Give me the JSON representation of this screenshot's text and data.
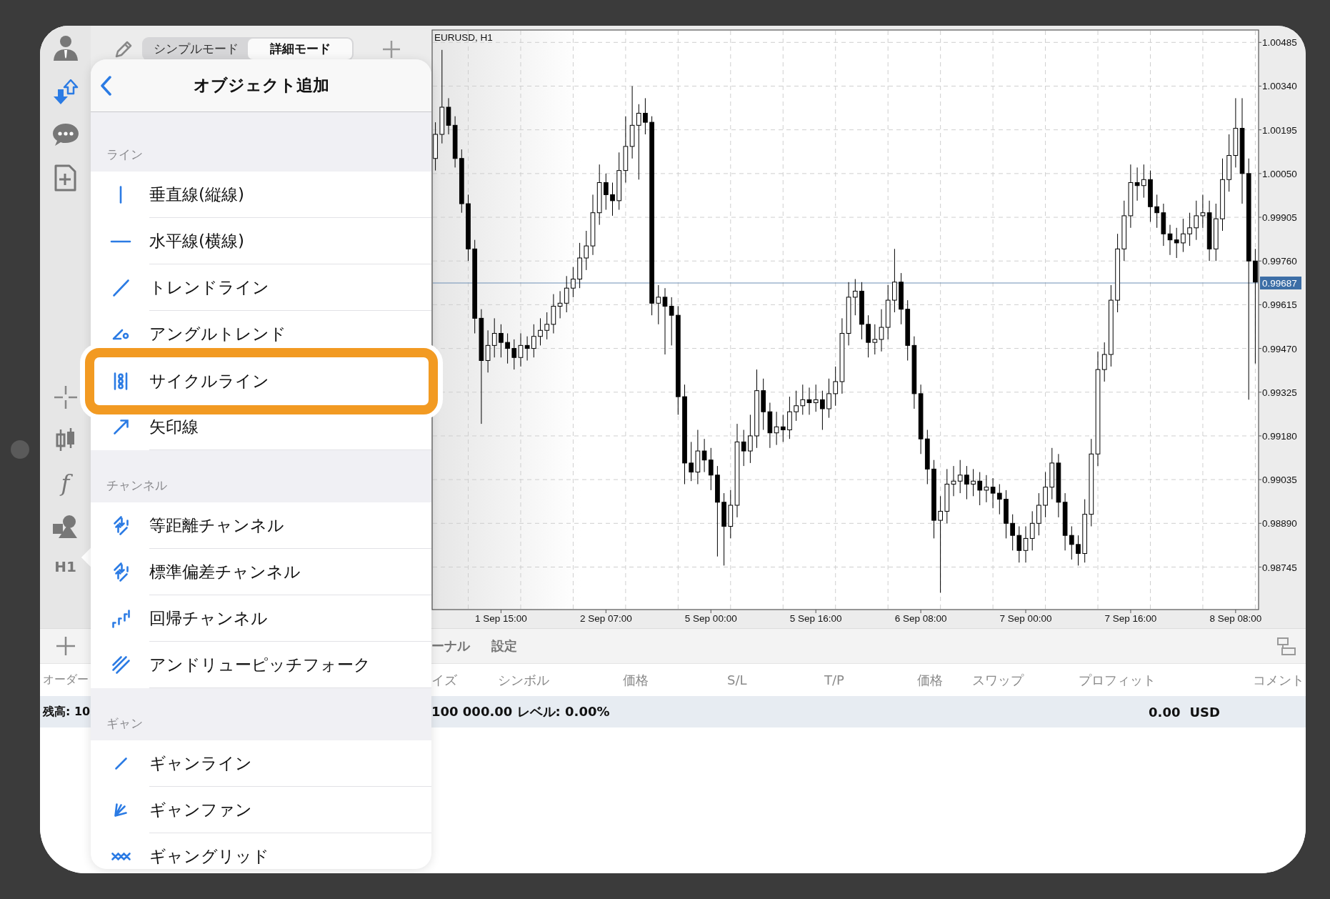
{
  "sidebar": {
    "indicator_glyph": "f",
    "timeframe": "H1"
  },
  "mode_tabs": [
    {
      "label": "シンプルモード",
      "selected": false
    },
    {
      "label": "詳細モード",
      "selected": true
    }
  ],
  "popover": {
    "title": "オブジェクト追加",
    "sections": [
      {
        "title": "ライン",
        "items": [
          {
            "label": "垂直線(縦線)",
            "selected": false
          },
          {
            "label": "水平線(横線)",
            "selected": false
          },
          {
            "label": "トレンドライン",
            "selected": false
          },
          {
            "label": "アングルトレンド",
            "selected": false
          },
          {
            "label": "サイクルライン",
            "selected": true
          },
          {
            "label": "矢印線",
            "selected": false
          }
        ]
      },
      {
        "title": "チャンネル",
        "items": [
          {
            "label": "等距離チャンネル",
            "selected": false
          },
          {
            "label": "標準偏差チャンネル",
            "selected": false
          },
          {
            "label": "回帰チャンネル",
            "selected": false
          },
          {
            "label": "アンドリューピッチフォーク",
            "selected": false
          }
        ]
      },
      {
        "title": "ギャン",
        "items": [
          {
            "label": "ギャンライン",
            "selected": false
          },
          {
            "label": "ギャンファン",
            "selected": false
          },
          {
            "label": "ギャングリッド",
            "selected": false
          }
        ]
      }
    ]
  },
  "chart": {
    "chart_data": {
      "type": "candlestick",
      "title": "EURUSD, H1",
      "grid": true,
      "ref_lines": [
        {
          "axis": "y",
          "value": 0.99687,
          "label": "0.99687"
        }
      ],
      "categories": [
        null,
        null,
        null,
        null,
        null,
        null,
        null,
        null,
        null,
        null,
        "1 Sep 15:00",
        null,
        null,
        null,
        null,
        null,
        null,
        null,
        null,
        null,
        null,
        null,
        null,
        null,
        null,
        null,
        "2 Sep 07:00",
        null,
        null,
        null,
        null,
        null,
        null,
        null,
        null,
        null,
        null,
        null,
        null,
        null,
        null,
        null,
        "5 Sep 00:00",
        null,
        null,
        null,
        null,
        null,
        null,
        null,
        null,
        null,
        null,
        null,
        null,
        null,
        null,
        null,
        "5 Sep 16:00",
        null,
        null,
        null,
        null,
        null,
        null,
        null,
        null,
        null,
        null,
        null,
        null,
        null,
        null,
        null,
        "6 Sep 08:00",
        null,
        null,
        null,
        null,
        null,
        null,
        null,
        null,
        null,
        null,
        null,
        null,
        null,
        null,
        null,
        "7 Sep 00:00",
        null,
        null,
        null,
        null,
        null,
        null,
        null,
        null,
        null,
        null,
        null,
        null,
        null,
        null,
        null,
        "7 Sep 16:00",
        null,
        null,
        null,
        null,
        null,
        null,
        null,
        null,
        null,
        null,
        null,
        null,
        null,
        null,
        null,
        "8 Sep 08:00",
        null,
        null,
        null
      ],
      "ylim": [
        0.98604,
        1.00526
      ],
      "yticks": [
        {
          "value": 1.00485,
          "label": "1.00485"
        },
        {
          "value": 1.0034,
          "label": "1.00340"
        },
        {
          "value": 1.00195,
          "label": "1.00195"
        },
        {
          "value": 1.0005,
          "label": "1.00050"
        },
        {
          "value": 0.99905,
          "label": "0.99905"
        },
        {
          "value": 0.9976,
          "label": "0.99760"
        },
        {
          "value": 0.99615,
          "label": "0.99615"
        },
        {
          "value": 0.9947,
          "label": "0.99470"
        },
        {
          "value": 0.99325,
          "label": "0.99325"
        },
        {
          "value": 0.9918,
          "label": "0.99180"
        },
        {
          "value": 0.99035,
          "label": "0.99035"
        },
        {
          "value": 0.9889,
          "label": "0.98890"
        },
        {
          "value": 0.98745,
          "label": "0.98745"
        }
      ],
      "ohlc": [
        [
          1.001,
          1.0022,
          1.0006,
          1.0018
        ],
        [
          1.0018,
          1.0046,
          1.0015,
          1.0027
        ],
        [
          1.0027,
          1.003,
          1.0018,
          1.0021
        ],
        [
          1.0021,
          1.0024,
          1.0007,
          1.001
        ],
        [
          1.001,
          1.0013,
          0.9992,
          0.9995
        ],
        [
          0.9995,
          0.9998,
          0.9976,
          0.998
        ],
        [
          0.998,
          0.9983,
          0.9952,
          0.9957
        ],
        [
          0.9957,
          0.996,
          0.9922,
          0.9943
        ],
        [
          0.9943,
          0.9953,
          0.9939,
          0.9948
        ],
        [
          0.9948,
          0.9957,
          0.9944,
          0.9952
        ],
        [
          0.9952,
          0.9955,
          0.9944,
          0.9949
        ],
        [
          0.9949,
          0.9952,
          0.9942,
          0.9947
        ],
        [
          0.9947,
          0.995,
          0.994,
          0.9944
        ],
        [
          0.9944,
          0.9952,
          0.9941,
          0.9948
        ],
        [
          0.9948,
          0.9951,
          0.9943,
          0.9947
        ],
        [
          0.9947,
          0.9955,
          0.9944,
          0.9951
        ],
        [
          0.9951,
          0.9957,
          0.9948,
          0.9953
        ],
        [
          0.9953,
          0.9959,
          0.995,
          0.9955
        ],
        [
          0.9955,
          0.9965,
          0.9952,
          0.9961
        ],
        [
          0.9961,
          0.9966,
          0.9957,
          0.9962
        ],
        [
          0.9962,
          0.9971,
          0.9959,
          0.9967
        ],
        [
          0.9967,
          0.9974,
          0.9964,
          0.997
        ],
        [
          0.997,
          0.9982,
          0.9967,
          0.9977
        ],
        [
          0.9977,
          0.9986,
          0.9973,
          0.9981
        ],
        [
          0.9981,
          0.9998,
          0.9978,
          0.9992
        ],
        [
          0.9992,
          1.0008,
          0.9988,
          1.0002
        ],
        [
          1.0002,
          1.0005,
          0.9993,
          0.9998
        ],
        [
          0.9998,
          1.0002,
          0.9991,
          0.9996
        ],
        [
          0.9996,
          1.0012,
          0.9993,
          1.0006
        ],
        [
          1.0006,
          1.0024,
          1.0002,
          1.0014
        ],
        [
          1.0014,
          1.0034,
          1.001,
          1.0021
        ],
        [
          1.0021,
          1.0028,
          1.0003,
          1.0025
        ],
        [
          1.0025,
          1.003,
          1.0018,
          1.0022
        ],
        [
          1.0022,
          1.0024,
          0.9958,
          0.9962
        ],
        [
          0.9962,
          0.9968,
          0.9955,
          0.9964
        ],
        [
          0.9964,
          0.9967,
          0.9945,
          0.9961
        ],
        [
          0.9961,
          0.9964,
          0.9948,
          0.9958
        ],
        [
          0.9958,
          0.9961,
          0.9925,
          0.9931
        ],
        [
          0.9931,
          0.9935,
          0.9902,
          0.9909
        ],
        [
          0.9909,
          0.9916,
          0.9903,
          0.9906
        ],
        [
          0.9906,
          0.992,
          0.9902,
          0.9913
        ],
        [
          0.9913,
          0.9917,
          0.9906,
          0.991
        ],
        [
          0.991,
          0.9914,
          0.99,
          0.9905
        ],
        [
          0.9905,
          0.9908,
          0.9878,
          0.9896
        ],
        [
          0.9896,
          0.9899,
          0.9875,
          0.9888
        ],
        [
          0.9888,
          0.99,
          0.9884,
          0.9895
        ],
        [
          0.9895,
          0.9922,
          0.9891,
          0.9916
        ],
        [
          0.9916,
          0.992,
          0.9908,
          0.9913
        ],
        [
          0.9913,
          0.9925,
          0.9909,
          0.9918
        ],
        [
          0.9918,
          0.994,
          0.9914,
          0.9933
        ],
        [
          0.9933,
          0.9937,
          0.992,
          0.9926
        ],
        [
          0.9926,
          0.9929,
          0.9914,
          0.9919
        ],
        [
          0.9919,
          0.9926,
          0.9915,
          0.9921
        ],
        [
          0.9921,
          0.9925,
          0.9916,
          0.992
        ],
        [
          0.992,
          0.9931,
          0.9917,
          0.9926
        ],
        [
          0.9926,
          0.9933,
          0.9923,
          0.9928
        ],
        [
          0.9928,
          0.9935,
          0.9925,
          0.993
        ],
        [
          0.993,
          0.9934,
          0.9925,
          0.9929
        ],
        [
          0.9929,
          0.9935,
          0.9926,
          0.993
        ],
        [
          0.993,
          0.9933,
          0.992,
          0.9927
        ],
        [
          0.9927,
          0.9937,
          0.9924,
          0.9932
        ],
        [
          0.9932,
          0.9941,
          0.9928,
          0.9936
        ],
        [
          0.9936,
          0.9957,
          0.9932,
          0.9952
        ],
        [
          0.9952,
          0.9969,
          0.9948,
          0.9964
        ],
        [
          0.9964,
          0.997,
          0.9958,
          0.9966
        ],
        [
          0.9966,
          0.9969,
          0.995,
          0.9955
        ],
        [
          0.9955,
          0.9958,
          0.9944,
          0.9949
        ],
        [
          0.9949,
          0.9955,
          0.9945,
          0.995
        ],
        [
          0.995,
          0.996,
          0.9946,
          0.9954
        ],
        [
          0.9954,
          0.9968,
          0.995,
          0.9963
        ],
        [
          0.9963,
          0.998,
          0.9959,
          0.9969
        ],
        [
          0.9969,
          0.9972,
          0.9955,
          0.996
        ],
        [
          0.996,
          0.9963,
          0.9943,
          0.9948
        ],
        [
          0.9948,
          0.9951,
          0.9927,
          0.9932
        ],
        [
          0.9932,
          0.9935,
          0.9912,
          0.9917
        ],
        [
          0.9917,
          0.992,
          0.9902,
          0.9907
        ],
        [
          0.9907,
          0.991,
          0.9884,
          0.989
        ],
        [
          0.989,
          0.9898,
          0.9866,
          0.9893
        ],
        [
          0.9893,
          0.9907,
          0.9889,
          0.9902
        ],
        [
          0.9902,
          0.9908,
          0.9898,
          0.9903
        ],
        [
          0.9903,
          0.991,
          0.9899,
          0.9905
        ],
        [
          0.9905,
          0.9908,
          0.9897,
          0.9902
        ],
        [
          0.9902,
          0.9907,
          0.9898,
          0.9903
        ],
        [
          0.9903,
          0.9906,
          0.9895,
          0.99
        ],
        [
          0.99,
          0.9905,
          0.9896,
          0.9901
        ],
        [
          0.9901,
          0.9904,
          0.9894,
          0.9899
        ],
        [
          0.9899,
          0.9902,
          0.9892,
          0.9897
        ],
        [
          0.9897,
          0.99,
          0.9884,
          0.9889
        ],
        [
          0.9889,
          0.9892,
          0.988,
          0.9885
        ],
        [
          0.9885,
          0.9888,
          0.9876,
          0.988
        ],
        [
          0.988,
          0.9888,
          0.9876,
          0.9884
        ],
        [
          0.9884,
          0.9893,
          0.988,
          0.9889
        ],
        [
          0.9889,
          0.9899,
          0.9885,
          0.9895
        ],
        [
          0.9895,
          0.9906,
          0.9891,
          0.9901
        ],
        [
          0.9901,
          0.9914,
          0.9897,
          0.9909
        ],
        [
          0.9909,
          0.9912,
          0.9891,
          0.9896
        ],
        [
          0.9896,
          0.9899,
          0.988,
          0.9885
        ],
        [
          0.9885,
          0.9888,
          0.9877,
          0.9882
        ],
        [
          0.9882,
          0.9885,
          0.9875,
          0.9879
        ],
        [
          0.9879,
          0.9897,
          0.9876,
          0.9892
        ],
        [
          0.9892,
          0.9917,
          0.9888,
          0.9912
        ],
        [
          0.9912,
          0.9946,
          0.9908,
          0.994
        ],
        [
          0.994,
          0.9949,
          0.9936,
          0.9945
        ],
        [
          0.9945,
          0.9968,
          0.9941,
          0.9963
        ],
        [
          0.9963,
          0.9985,
          0.9959,
          0.998
        ],
        [
          0.998,
          0.9996,
          0.9976,
          0.9991
        ],
        [
          0.9991,
          1.0008,
          0.9987,
          1.0002
        ],
        [
          1.0002,
          1.0007,
          0.9996,
          1.0001
        ],
        [
          1.0001,
          1.0008,
          0.9997,
          1.0003
        ],
        [
          1.0003,
          1.0006,
          0.9989,
          0.9994
        ],
        [
          0.9994,
          0.9998,
          0.9987,
          0.9992
        ],
        [
          0.9992,
          0.9995,
          0.9981,
          0.9985
        ],
        [
          0.9985,
          0.9988,
          0.9978,
          0.9983
        ],
        [
          0.9983,
          0.9987,
          0.9977,
          0.9982
        ],
        [
          0.9982,
          0.999,
          0.9979,
          0.9985
        ],
        [
          0.9985,
          0.9992,
          0.9981,
          0.9987
        ],
        [
          0.9987,
          0.9996,
          0.9983,
          0.9991
        ],
        [
          0.9991,
          0.9998,
          0.9987,
          0.9992
        ],
        [
          0.9992,
          0.9996,
          0.9976,
          0.998
        ],
        [
          0.998,
          0.9995,
          0.9976,
          0.999
        ],
        [
          0.999,
          1.001,
          0.9986,
          1.0003
        ],
        [
          1.0003,
          1.0018,
          0.9999,
          1.0011
        ],
        [
          1.0011,
          1.003,
          1.0007,
          1.002
        ],
        [
          1.002,
          1.003,
          0.9995,
          1.0005
        ],
        [
          1.0005,
          1.001,
          0.993,
          0.9976
        ],
        [
          0.9976,
          0.998,
          0.9942,
          0.9969
        ]
      ]
    }
  },
  "bottom_panel": {
    "tabs": [
      "ーナル",
      "設定"
    ],
    "order_column": "オーダー",
    "columns": [
      "イズ",
      "シンボル",
      "価格",
      "S/L",
      "T/P",
      "価格",
      "スワップ",
      "プロフィット",
      "コメント"
    ],
    "balance": {
      "label": "残高: 10",
      "summary": "100 000.00 レベル: 0.00%",
      "profit": "0.00",
      "currency": "USD"
    }
  }
}
